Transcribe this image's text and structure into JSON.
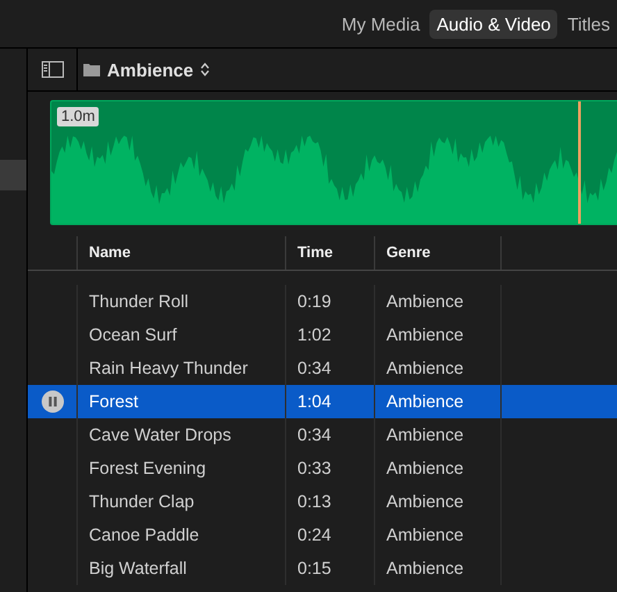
{
  "tabs": [
    {
      "label": "My Media",
      "selected": false
    },
    {
      "label": "Audio & Video",
      "selected": true
    },
    {
      "label": "Titles",
      "selected": false
    }
  ],
  "library": {
    "folder": "Ambience"
  },
  "clip": {
    "duration": "1.0m"
  },
  "table": {
    "columns": [
      "Name",
      "Time",
      "Genre"
    ],
    "rows": [
      {
        "name": "Thunder Roll",
        "time": "0:19",
        "genre": "Ambience",
        "selected": false,
        "playing": false
      },
      {
        "name": "Ocean Surf",
        "time": "1:02",
        "genre": "Ambience",
        "selected": false,
        "playing": false
      },
      {
        "name": "Rain Heavy Thunder",
        "time": "0:34",
        "genre": "Ambience",
        "selected": false,
        "playing": false
      },
      {
        "name": "Forest",
        "time": "1:04",
        "genre": "Ambience",
        "selected": true,
        "playing": true
      },
      {
        "name": "Cave Water Drops",
        "time": "0:34",
        "genre": "Ambience",
        "selected": false,
        "playing": false
      },
      {
        "name": "Forest Evening",
        "time": "0:33",
        "genre": "Ambience",
        "selected": false,
        "playing": false
      },
      {
        "name": "Thunder Clap",
        "time": "0:13",
        "genre": "Ambience",
        "selected": false,
        "playing": false
      },
      {
        "name": "Canoe Paddle",
        "time": "0:24",
        "genre": "Ambience",
        "selected": false,
        "playing": false
      },
      {
        "name": "Big Waterfall",
        "time": "0:15",
        "genre": "Ambience",
        "selected": false,
        "playing": false
      }
    ]
  }
}
